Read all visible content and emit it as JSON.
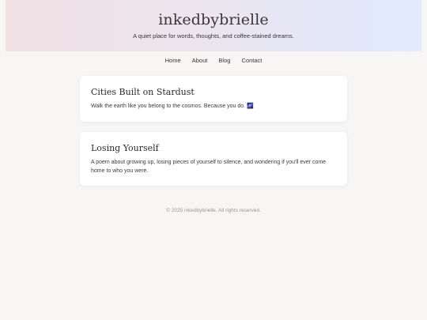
{
  "header": {
    "title": "inkedbybrielle",
    "tagline": "A quiet place for words, thoughts, and coffee-stained dreams."
  },
  "nav": {
    "items": [
      {
        "label": "Home"
      },
      {
        "label": "About"
      },
      {
        "label": "Blog"
      },
      {
        "label": "Contact"
      }
    ]
  },
  "posts": [
    {
      "title": "Cities Built on Stardust",
      "excerpt": "Walk the earth like you belong to the cosmos. Because you do. 🌌"
    },
    {
      "title": "Losing Yourself",
      "excerpt": "A poem about growing up, losing pieces of yourself to silence, and wondering if you'll ever come home to who you were."
    }
  ],
  "footer": {
    "text": "© 2025 inkedbybrielle. All rights reserved."
  }
}
